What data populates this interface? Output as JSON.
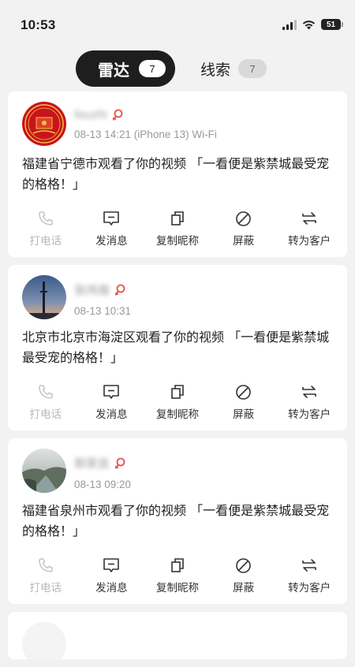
{
  "status_bar": {
    "time": "10:53",
    "battery": "51"
  },
  "tabs": [
    {
      "label": "雷达",
      "count": "7",
      "active": true
    },
    {
      "label": "线索",
      "count": "7",
      "active": false
    }
  ],
  "cards": [
    {
      "nickname": "lisuzhi",
      "meta": "08-13 14:21 (iPhone 13) Wi-Fi",
      "message": "福建省宁德市观看了你的视频 「一看便是紫禁城最受宠的格格！」",
      "avatar_icon": "red-seal-avatar"
    },
    {
      "nickname": "张炜煌",
      "meta": "08-13 10:31",
      "message": "北京市北京市海淀区观看了你的视频 「一看便是紫禁城最受宠的格格！」",
      "avatar_icon": "sunset-tower-avatar"
    },
    {
      "nickname": "郭荣良",
      "meta": "08-13 09:20",
      "message": "福建省泉州市观看了你的视频 「一看便是紫禁城最受宠的格格！」",
      "avatar_icon": "landscape-avatar"
    }
  ],
  "actions": {
    "call": "打电话",
    "message": "发消息",
    "copy_nick": "复制昵称",
    "block": "屏蔽",
    "convert": "转为客户"
  },
  "colors": {
    "female_icon": "#e8504a",
    "active_tab": "#1e1e1e"
  }
}
